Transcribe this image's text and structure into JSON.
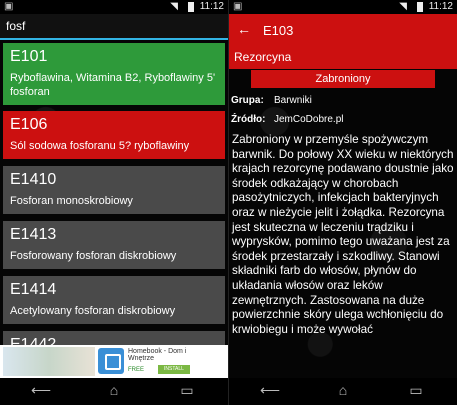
{
  "status_bar": {
    "time": "11:12"
  },
  "search": {
    "query": "fosf"
  },
  "list": {
    "items": [
      {
        "code": "E101",
        "name": "Ryboflawina, Witamina B2, Ryboflawiny 5' fosforan",
        "color": "#2e9a3a"
      },
      {
        "code": "E106",
        "name": "Sól sodowa fosforanu 5? ryboflawiny",
        "color": "#cc1010"
      },
      {
        "code": "E1410",
        "name": "Fosforan monoskrobiowy",
        "color": "#4a4a4a"
      },
      {
        "code": "E1413",
        "name": "Fosforowany fosforan diskrobiowy",
        "color": "#4a4a4a"
      },
      {
        "code": "E1414",
        "name": "Acetylowany fosforan diskrobiowy",
        "color": "#4a4a4a"
      },
      {
        "code": "E1442",
        "name": "",
        "color": "#4a4a4a"
      }
    ]
  },
  "ad": {
    "text": "Homebook - Dom i Wnętrze",
    "free": "FREE",
    "install": "INSTALL"
  },
  "detail": {
    "code": "E103",
    "name": "Rezorcyna",
    "status": "Zabroniony",
    "group_label": "Grupa:",
    "group_value": "Barwniki",
    "source_label": "Źródło:",
    "source_value": "JemCoDobre.pl",
    "description": "Zabroniony w przemyśle spożywczym barwnik. Do połowy XX wieku w niektórych krajach rezorcynę podawano doustnie jako środek odkażający w chorobach pasożytniczych, infekcjach bakteryjnych oraz w nieżycie jelit i żołądka. Rezorcyna jest skuteczna w leczeniu trądziku i wyprysków, pomimo tego uważana jest za środek przestarzały i szkodliwy. Stanowi składniki farb do włosów, płynów do układania włosów oraz leków zewnętrznych. Zastosowana na duże powierzchnie skóry ulega wchłonięciu do krwiobiegu i może wywołać"
  },
  "colors": {
    "accent": "#cc1010",
    "green": "#2e9a3a",
    "gray": "#4a4a4a"
  }
}
